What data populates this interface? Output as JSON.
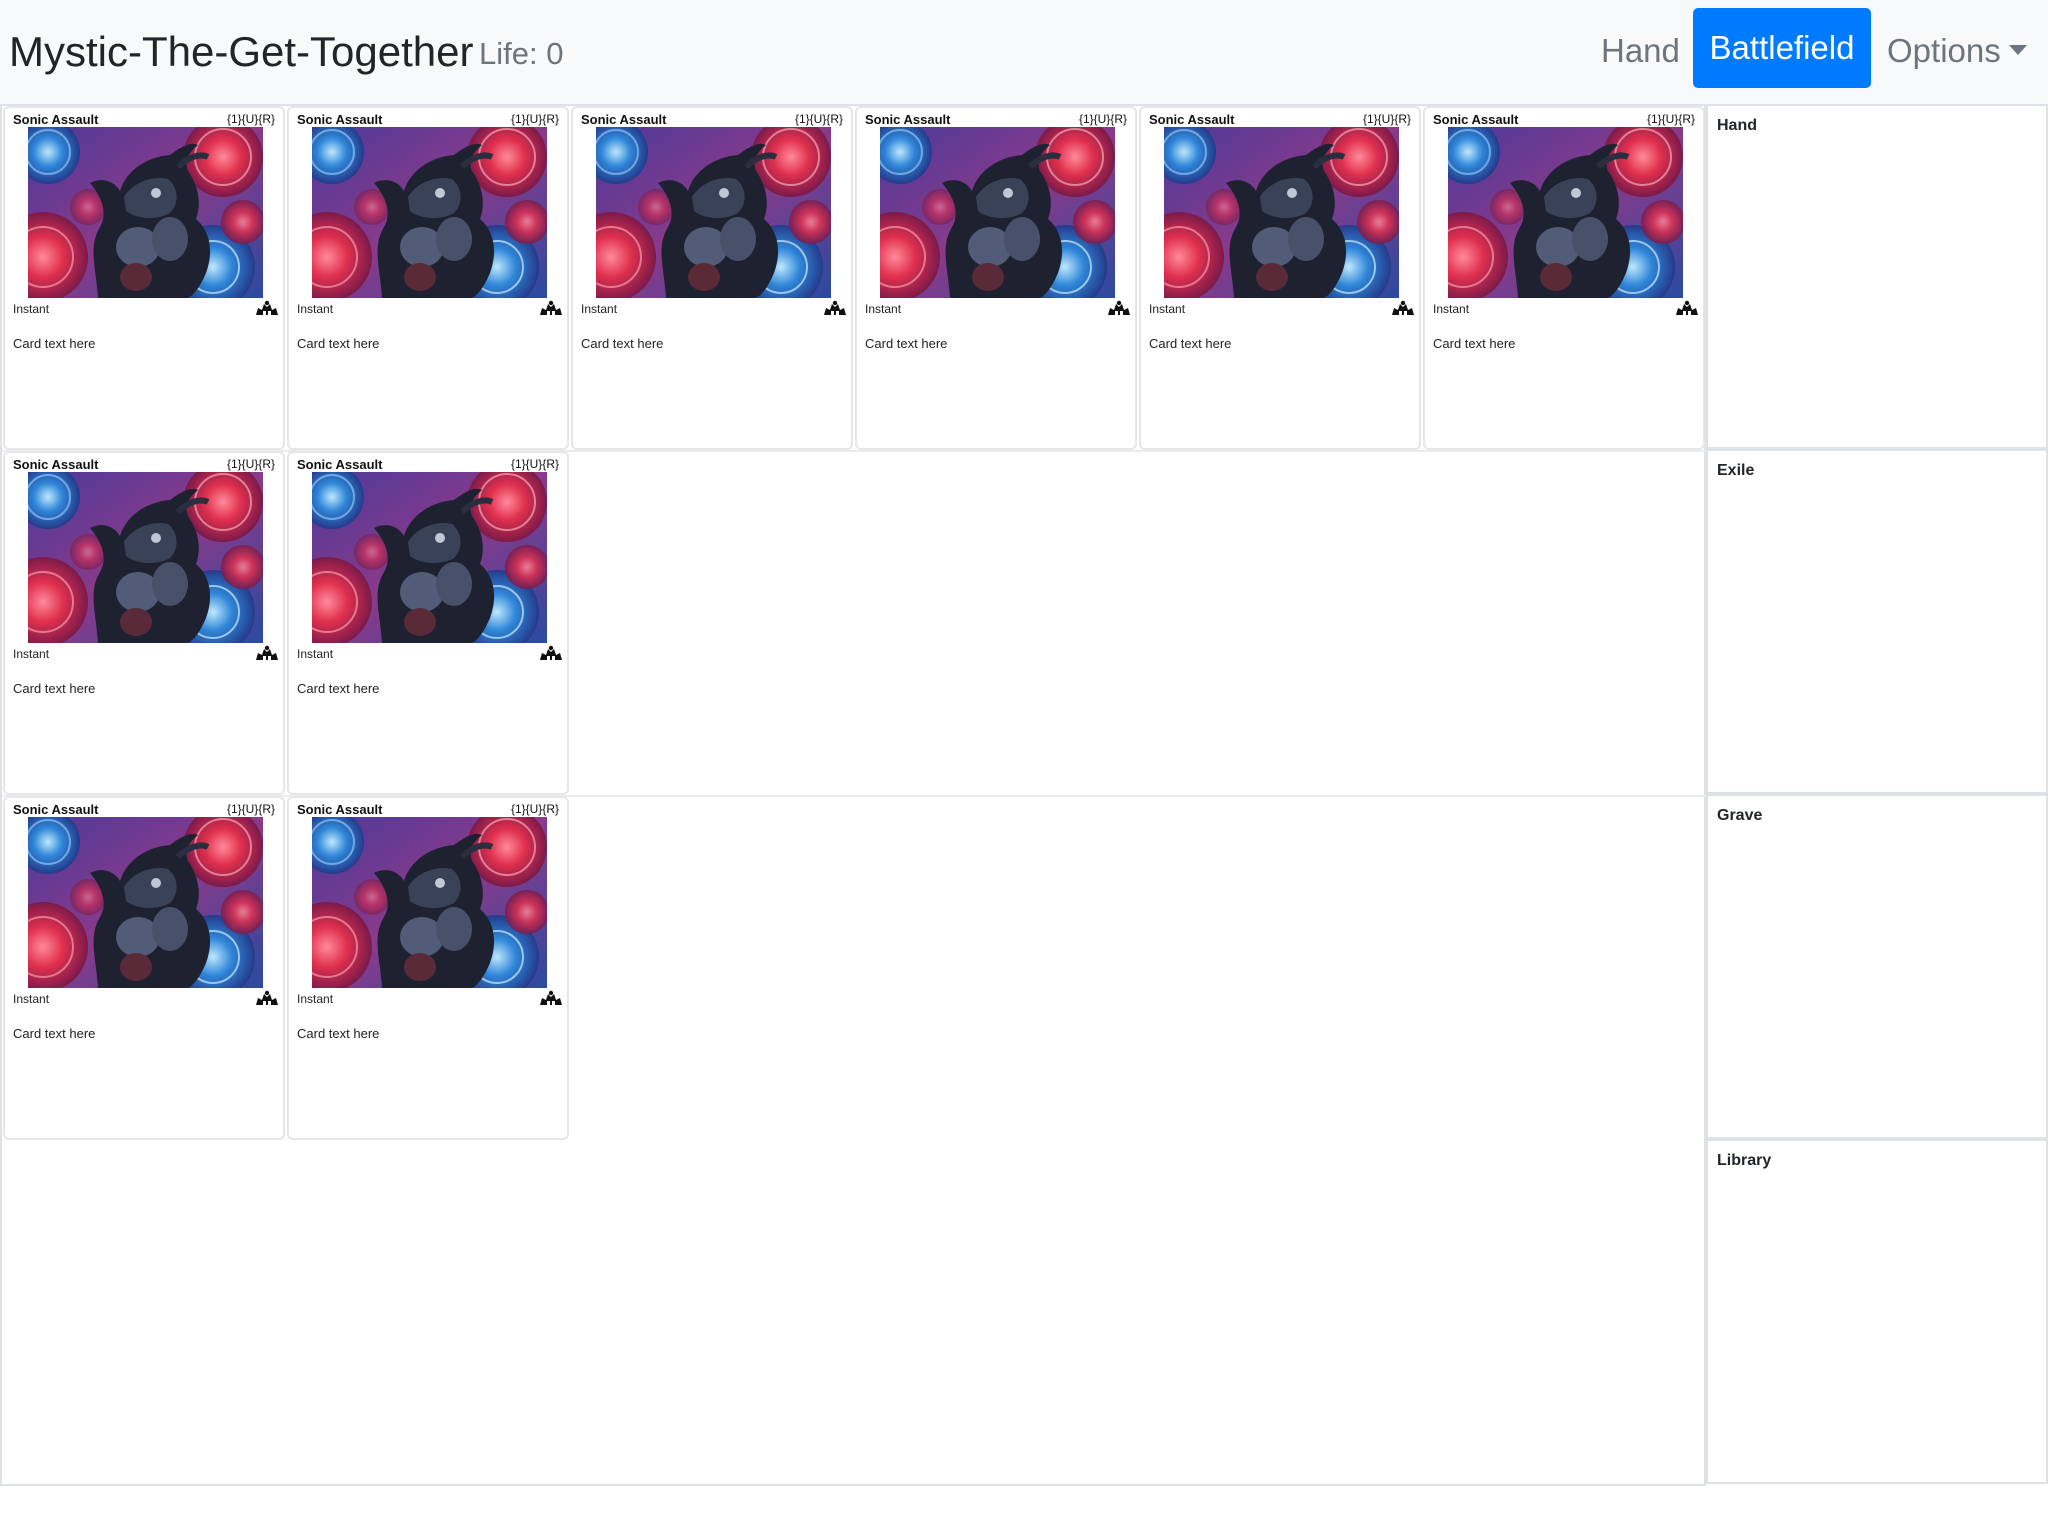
{
  "app": {
    "title": "Mystic-The-Get-Together",
    "life": "Life: 0"
  },
  "nav": {
    "hand": "Hand",
    "battlefield": "Battlefield",
    "options": "Options"
  },
  "card": {
    "name": "Sonic Assault",
    "cost": "{1}{U}{R}",
    "type": "Instant",
    "text": "Card text here",
    "art_icon": "sonic-assault-art",
    "set_icon": "set-symbol-icon"
  },
  "battlefield": {
    "rows": [
      {
        "cards": 6
      },
      {
        "cards": 2
      },
      {
        "cards": 2
      }
    ]
  },
  "zones": {
    "hand": "Hand",
    "exile": "Exile",
    "grave": "Grave",
    "library": "Library"
  },
  "colors": {
    "accent": "#007bff",
    "navbar": "#f8f9fa",
    "muted": "#6c757d"
  }
}
